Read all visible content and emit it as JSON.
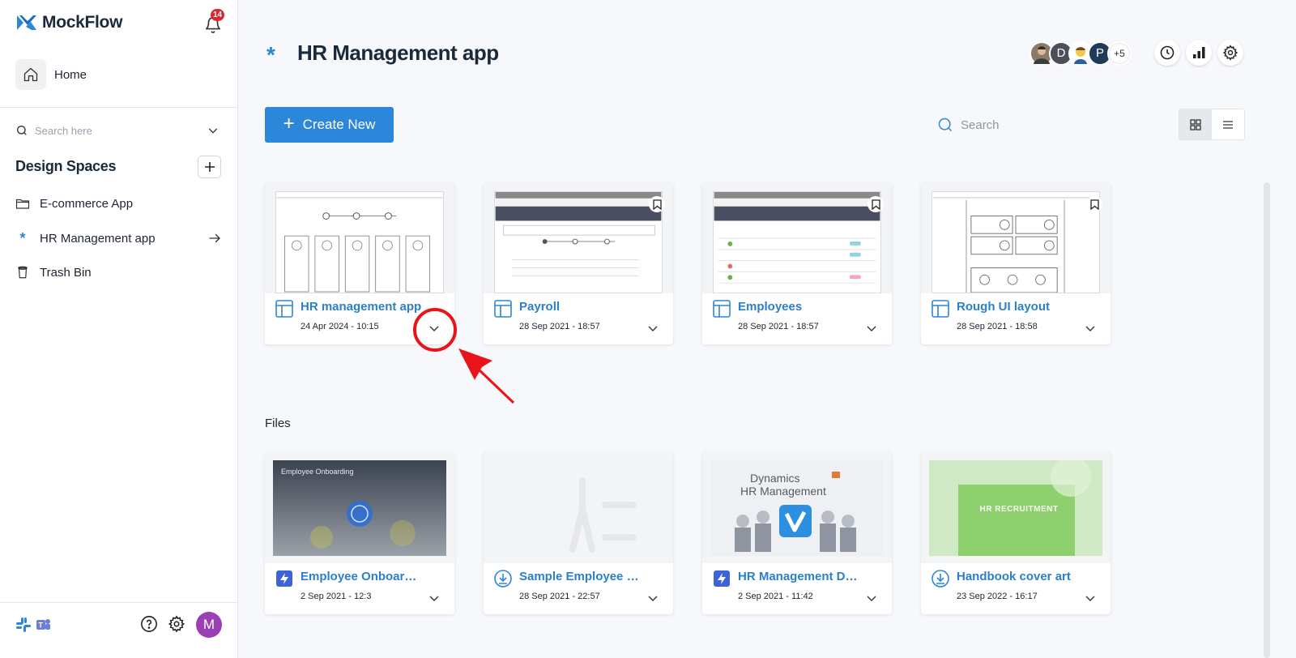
{
  "sidebar": {
    "brand": "MockFlow",
    "notification_count": "14",
    "home_label": "Home",
    "search_placeholder": "Search here",
    "design_spaces_title": "Design Spaces",
    "items": [
      {
        "label": "E-commerce App",
        "icon": "folder-icon"
      },
      {
        "label": "HR Management app",
        "icon": "asterisk-icon",
        "active": true
      },
      {
        "label": "Trash Bin",
        "icon": "trash-icon"
      }
    ],
    "footer": {
      "avatar_initial": "M",
      "avatar_color": "#9b3fb5"
    }
  },
  "header": {
    "title": "HR Management app",
    "members": [
      {
        "initial": "",
        "color": "#8a7a6a"
      },
      {
        "initial": "D",
        "color": "#4a4f5a"
      },
      {
        "initial": "",
        "color": "#f2c94c"
      },
      {
        "initial": "P",
        "color": "#1f3b5a"
      }
    ],
    "members_more": "+5"
  },
  "toolbar": {
    "create_label": "Create New",
    "search_placeholder": "Search",
    "accent": "#2c86d9"
  },
  "designs": [
    {
      "title": "HR management app",
      "date": "24 Apr 2024 - 10:15",
      "type": "wireframe-icon"
    },
    {
      "title": "Payroll",
      "date": "28 Sep 2021 - 18:57",
      "type": "wireframe-icon"
    },
    {
      "title": "Employees",
      "date": "28 Sep 2021 - 18:57",
      "type": "wireframe-icon"
    },
    {
      "title": "Rough UI layout",
      "date": "28 Sep 2021 - 18:58",
      "type": "wireframe-icon"
    }
  ],
  "files_label": "Files",
  "files": [
    {
      "title": "Employee Onboarding",
      "date": "2 Sep 2021 - 12:3",
      "type": "lightning-icon",
      "thumb_text": "Employee Onboarding"
    },
    {
      "title": "Sample Employee Handbook",
      "date": "28 Sep 2021 - 22:57",
      "type": "download-icon"
    },
    {
      "title": "HR Management Dynamics",
      "date": "2 Sep 2021 - 11:42",
      "type": "lightning-icon",
      "thumb_text_1": "Dynamics",
      "thumb_text_2": "HR Management"
    },
    {
      "title": "Handbook cover art",
      "date": "23 Sep 2022 - 16:17",
      "type": "download-icon",
      "thumb_text": "HR RECRUITMENT"
    }
  ]
}
